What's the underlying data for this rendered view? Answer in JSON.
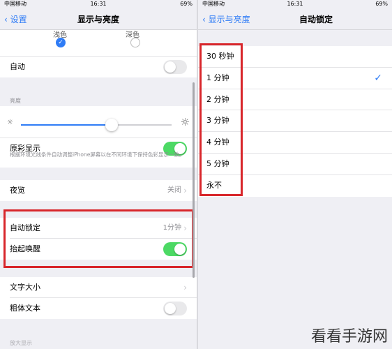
{
  "left": {
    "status": {
      "carrier": "中国移动",
      "time": "16:31",
      "battery": "69%"
    },
    "nav": {
      "back": "设置",
      "title": "显示与亮度"
    },
    "appearance": {
      "light": "浅色",
      "dark": "深色"
    },
    "auto_label": "自动",
    "brightness_header": "亮度",
    "brightness_level": 0.6,
    "true_tone_label": "原彩显示",
    "true_tone_desc": "根据环境光线条件自动调整iPhone屏幕以在不同环境下保持色彩显示一致。",
    "night_shift": {
      "label": "夜览",
      "value": "关闭"
    },
    "auto_lock": {
      "label": "自动锁定",
      "value": "1分钟"
    },
    "raise_to_wake": "抬起唤醒",
    "text_size": "文字大小",
    "bold_text": "粗体文本",
    "display_zoom_header": "放大显示",
    "toggles": {
      "auto": false,
      "true_tone": true,
      "raise_to_wake": true,
      "bold_text": false
    }
  },
  "right": {
    "status": {
      "carrier": "中国移动",
      "time": "16:31",
      "battery": "69%"
    },
    "nav": {
      "back": "显示与亮度",
      "title": "自动锁定"
    },
    "options": [
      "30 秒钟",
      "1 分钟",
      "2 分钟",
      "3 分钟",
      "4 分钟",
      "5 分钟",
      "永不"
    ],
    "selected_index": 1
  },
  "watermark": "看看手游网",
  "colors": {
    "accent": "#2f7cf6",
    "toggle_on": "#4cd964",
    "highlight": "#d8262b"
  }
}
